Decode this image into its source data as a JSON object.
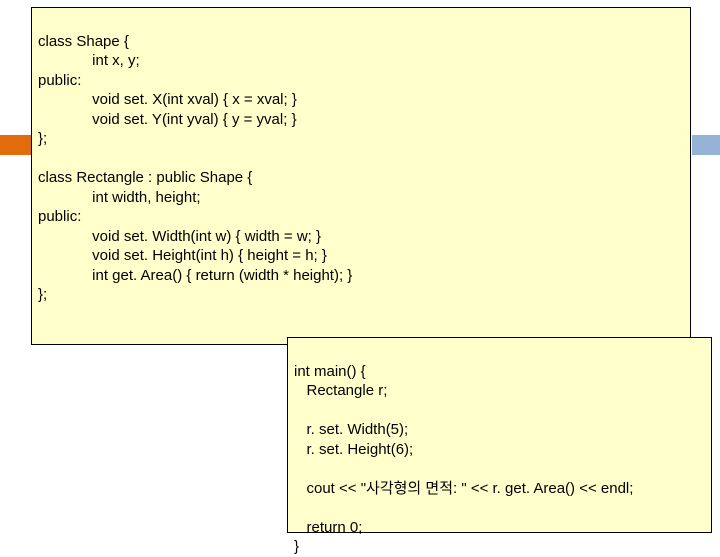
{
  "box1": {
    "l1": "class Shape {",
    "l2": "             int x, y;",
    "l3": "public:",
    "l4": "             void set. X(int xval) { x = xval; }",
    "l5": "             void set. Y(int yval) { y = yval; }",
    "l6": "};",
    "l7": "",
    "l8": "class Rectangle : public Shape {",
    "l9": "             int width, height;",
    "l10": "public:",
    "l11": "             void set. Width(int w) { width = w; }",
    "l12": "             void set. Height(int h) { height = h; }",
    "l13": "             int get. Area() { return (width * height); }",
    "l14": "};"
  },
  "box2": {
    "l1": "int main() {",
    "l2": "   Rectangle r;",
    "l3": "",
    "l4": "   r. set. Width(5);",
    "l5": "   r. set. Height(6);",
    "l6": "",
    "l7": "   cout << \"사각형의 면적: \" << r. get. Area() << endl;",
    "l8": "",
    "l9": "   return 0;",
    "l10": "}"
  }
}
